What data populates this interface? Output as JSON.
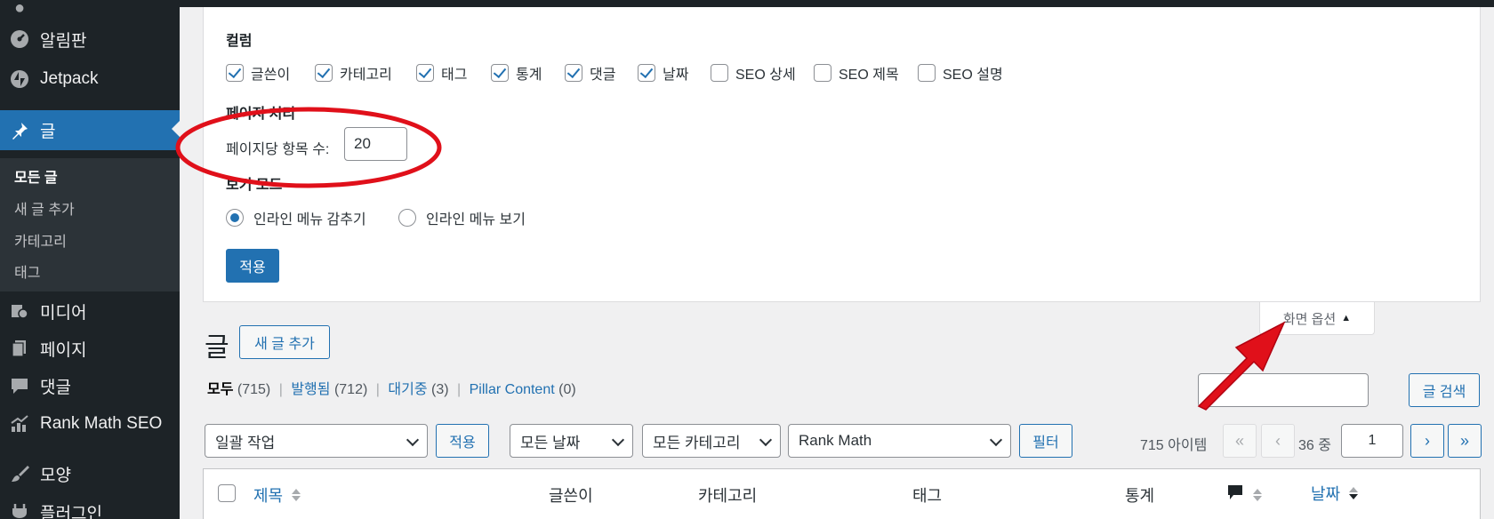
{
  "sidebar": {
    "items": [
      {
        "label": "알림판",
        "icon": "dashboard-icon"
      },
      {
        "label": "Jetpack",
        "icon": "jetpack-icon"
      },
      {
        "label": "글",
        "icon": "pushpin-icon"
      },
      {
        "label": "미디어",
        "icon": "media-icon"
      },
      {
        "label": "페이지",
        "icon": "pages-icon"
      },
      {
        "label": "댓글",
        "icon": "comment-icon"
      },
      {
        "label": "Rank Math SEO",
        "icon": "chart-icon"
      },
      {
        "label": "모양",
        "icon": "brush-icon"
      },
      {
        "label": "플러그인",
        "icon": "plugin-icon"
      }
    ],
    "submenu": [
      "모든 글",
      "새 글 추가",
      "카테고리",
      "태그"
    ]
  },
  "screen_options": {
    "columns_heading": "컬럼",
    "columns": [
      {
        "label": "글쓴이",
        "checked": true
      },
      {
        "label": "카테고리",
        "checked": true
      },
      {
        "label": "태그",
        "checked": true
      },
      {
        "label": "통계",
        "checked": true
      },
      {
        "label": "댓글",
        "checked": true
      },
      {
        "label": "날짜",
        "checked": true
      },
      {
        "label": "SEO 상세",
        "checked": false
      },
      {
        "label": "SEO 제목",
        "checked": false
      },
      {
        "label": "SEO 설명",
        "checked": false
      }
    ],
    "pagination_heading": "페이지 처리",
    "per_page_label": "페이지당 항목 수:",
    "per_page_value": "20",
    "view_mode_heading": "보기 모드",
    "view_modes": [
      {
        "label": "인라인 메뉴 감추기",
        "checked": true
      },
      {
        "label": "인라인 메뉴 보기",
        "checked": false
      }
    ],
    "apply_label": "적용",
    "tab_label": "화면 옵션",
    "tab_arrow": "▲"
  },
  "annotation_color": "#e0101a",
  "page": {
    "title": "글",
    "add_new_label": "새 글 추가",
    "views": [
      {
        "label": "모두",
        "count": "(715)"
      },
      {
        "label": "발행됨",
        "count": "(712)"
      },
      {
        "label": "대기중",
        "count": "(3)"
      },
      {
        "label": "Pillar Content",
        "count": "(0)"
      }
    ],
    "search_button": "글 검색"
  },
  "filters": {
    "bulk_action": "일괄 작업",
    "bulk_apply": "적용",
    "dates": "모든 날짜",
    "categories": "모든 카테고리",
    "rank_math": "Rank Math",
    "filter_button": "필터"
  },
  "pagination": {
    "items_count": "715 아이템",
    "first": "«",
    "prev": "‹",
    "total_pages_text": "36 중",
    "current_page": "1",
    "next": "›",
    "last": "»"
  },
  "table": {
    "headers": {
      "title": "제목",
      "author": "글쓴이",
      "categories": "카테고리",
      "tags": "태그",
      "stats": "통계",
      "date": "날짜"
    }
  }
}
